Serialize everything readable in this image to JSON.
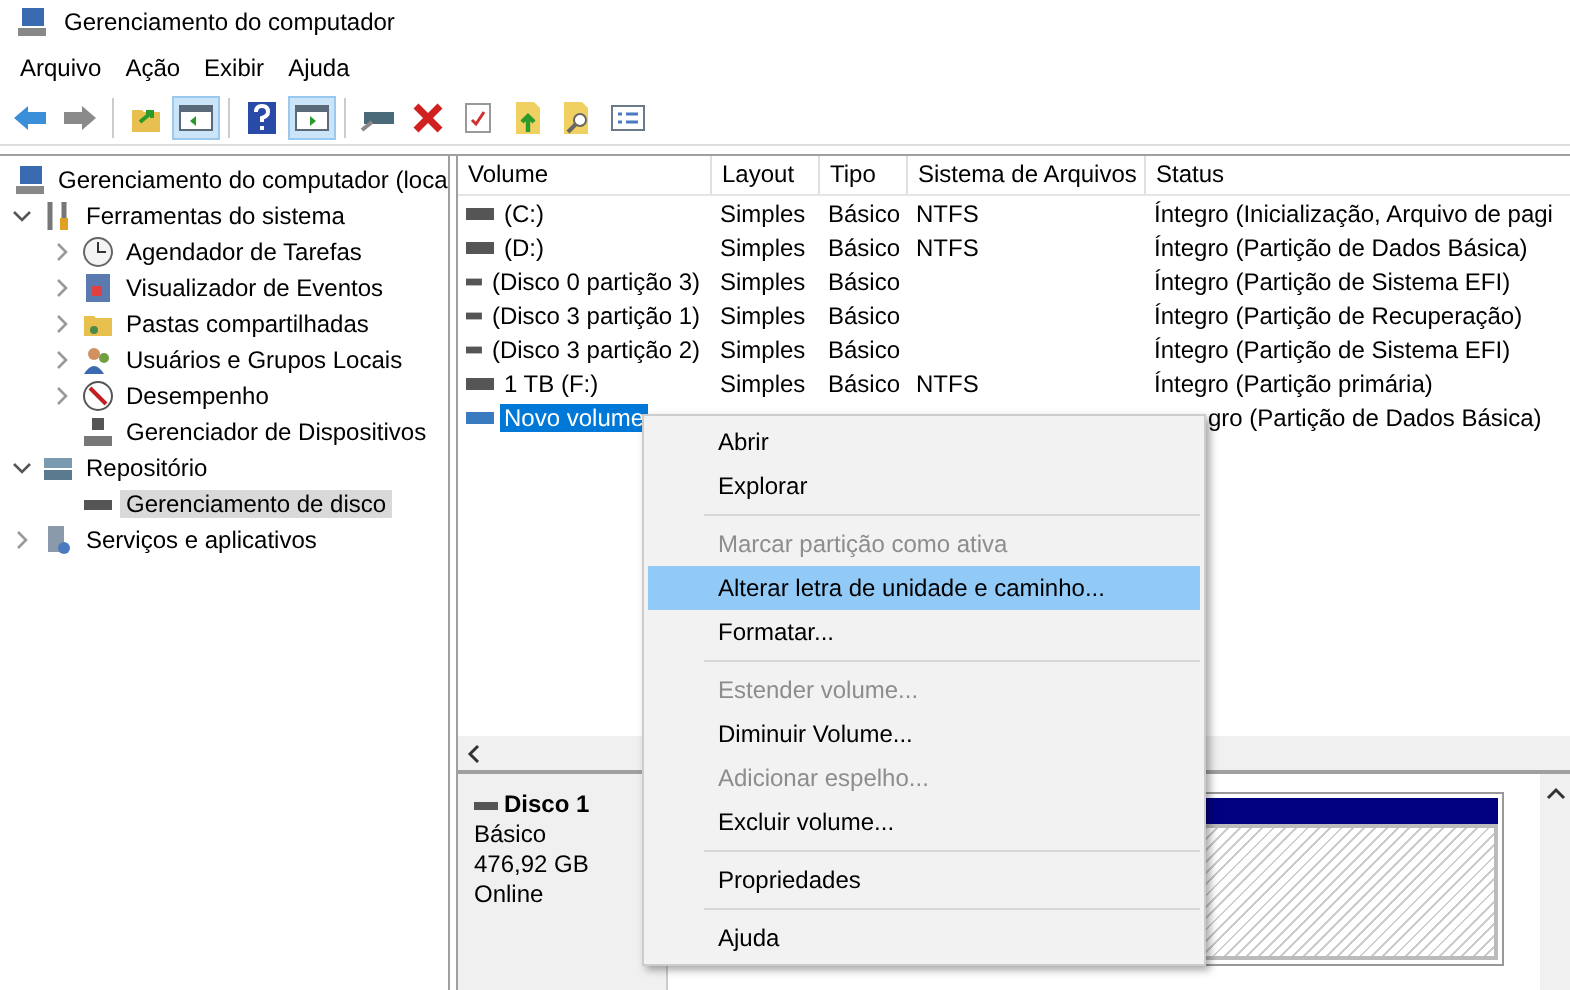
{
  "window": {
    "title": "Gerenciamento do computador"
  },
  "menu_bar": [
    "Arquivo",
    "Ação",
    "Exibir",
    "Ajuda"
  ],
  "toolbar": [
    {
      "kind": "button",
      "pressed": false
    },
    {
      "kind": "button",
      "pressed": false
    },
    {
      "kind": "separator"
    },
    {
      "kind": "button",
      "pressed": false
    },
    {
      "kind": "button",
      "pressed": true
    },
    {
      "kind": "separator"
    },
    {
      "kind": "button",
      "pressed": false
    },
    {
      "kind": "button",
      "pressed": true
    },
    {
      "kind": "separator"
    },
    {
      "kind": "button",
      "pressed": false
    },
    {
      "kind": "button",
      "pressed": false
    },
    {
      "kind": "button",
      "pressed": false
    },
    {
      "kind": "button",
      "pressed": false
    },
    {
      "kind": "button",
      "pressed": false
    },
    {
      "kind": "button",
      "pressed": false
    }
  ],
  "tree": [
    {
      "label": "Gerenciamento do computador (loca",
      "selected": false,
      "children": [
        {
          "label": "Ferramentas do sistema",
          "selected": false,
          "expanded": true,
          "children": [
            {
              "label": "Agendador de Tarefas",
              "selected": false,
              "expanded": false
            },
            {
              "label": "Visualizador de Eventos",
              "selected": false,
              "expanded": false
            },
            {
              "label": "Pastas compartilhadas",
              "selected": false,
              "expanded": false
            },
            {
              "label": "Usuários e Grupos Locais",
              "selected": false,
              "expanded": false
            },
            {
              "label": "Desempenho",
              "selected": false,
              "expanded": false
            },
            {
              "label": "Gerenciador de Dispositivos",
              "selected": false
            }
          ]
        },
        {
          "label": "Repositório",
          "selected": false,
          "expanded": true,
          "children": [
            {
              "label": "Gerenciamento de disco",
              "selected": true
            }
          ]
        },
        {
          "label": "Serviços e aplicativos",
          "selected": false,
          "expanded": false
        }
      ]
    }
  ],
  "table": {
    "columns": [
      "Volume",
      "Layout",
      "Tipo",
      "Sistema de Arquivos",
      "Status"
    ],
    "rows": [
      {
        "cells": [
          " (C:)",
          "Simples",
          "Básico",
          "NTFS",
          "Íntegro (Inicialização, Arquivo de pagi"
        ],
        "selected": false
      },
      {
        "cells": [
          " (D:)",
          "Simples",
          "Básico",
          "NTFS",
          "Íntegro (Partição de Dados Básica)"
        ],
        "selected": false
      },
      {
        "cells": [
          "(Disco 0 partição 3)",
          "Simples",
          "Básico",
          "",
          "Íntegro (Partição de Sistema EFI)"
        ],
        "selected": false
      },
      {
        "cells": [
          "(Disco 3 partição 1)",
          "Simples",
          "Básico",
          "",
          "Íntegro (Partição de Recuperação)"
        ],
        "selected": false
      },
      {
        "cells": [
          "(Disco 3 partição 2)",
          "Simples",
          "Básico",
          "",
          "Íntegro (Partição de Sistema EFI)"
        ],
        "selected": false
      },
      {
        "cells": [
          "1 TB (F:)",
          "Simples",
          "Básico",
          "NTFS",
          "Íntegro (Partição primária)"
        ],
        "selected": false
      },
      {
        "cells": [
          "Novo volume",
          "",
          "",
          "",
          "gro (Partição de Dados Básica)"
        ],
        "selected": true,
        "covered": true
      }
    ]
  },
  "disk": {
    "name": "Disco 1",
    "type": "Básico",
    "size": "476,92 GB",
    "state": "Online"
  },
  "context_menu": [
    {
      "kind": "item",
      "label": "Abrir",
      "disabled": false,
      "selected": false
    },
    {
      "kind": "item",
      "label": "Explorar",
      "disabled": false,
      "selected": false
    },
    {
      "kind": "separator"
    },
    {
      "kind": "item",
      "label": "Marcar partição como ativa",
      "disabled": true,
      "selected": false
    },
    {
      "kind": "item",
      "label": "Alterar letra de unidade e caminho...",
      "disabled": false,
      "selected": true
    },
    {
      "kind": "item",
      "label": "Formatar...",
      "disabled": false,
      "selected": false
    },
    {
      "kind": "separator"
    },
    {
      "kind": "item",
      "label": "Estender volume...",
      "disabled": true,
      "selected": false
    },
    {
      "kind": "item",
      "label": "Diminuir Volume...",
      "disabled": false,
      "selected": false
    },
    {
      "kind": "item",
      "label": "Adicionar espelho...",
      "disabled": true,
      "selected": false
    },
    {
      "kind": "item",
      "label": "Excluir volume...",
      "disabled": false,
      "selected": false
    },
    {
      "kind": "separator"
    },
    {
      "kind": "item",
      "label": "Propriedades",
      "disabled": false,
      "selected": false
    },
    {
      "kind": "separator"
    },
    {
      "kind": "item",
      "label": "Ajuda",
      "disabled": false,
      "selected": false
    }
  ]
}
